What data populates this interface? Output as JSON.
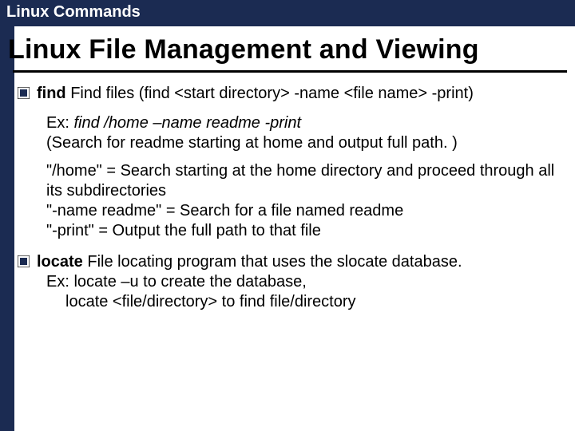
{
  "title_bar": "Linux Commands",
  "heading": "Linux File Management and Viewing",
  "find": {
    "cmd": "find",
    "desc_rest": " Find files (find <start directory> -name <file name> -print)",
    "ex_label": "Ex: ",
    "ex_cmd": "find /home –name readme -print",
    "ex_note": "(Search for readme starting at home and output full path. )",
    "detail1": "\"/home\" = Search starting at the home directory and proceed through all its subdirectories",
    "detail2": "\"-name readme\" = Search for a file named readme",
    "detail3": "\"-print\" = Output the full path to that file"
  },
  "locate": {
    "cmd": "locate",
    "desc_rest": " File locating program that uses the slocate database.",
    "ex1": "Ex: locate –u to create the database,",
    "ex2": "locate <file/directory> to find file/directory"
  }
}
